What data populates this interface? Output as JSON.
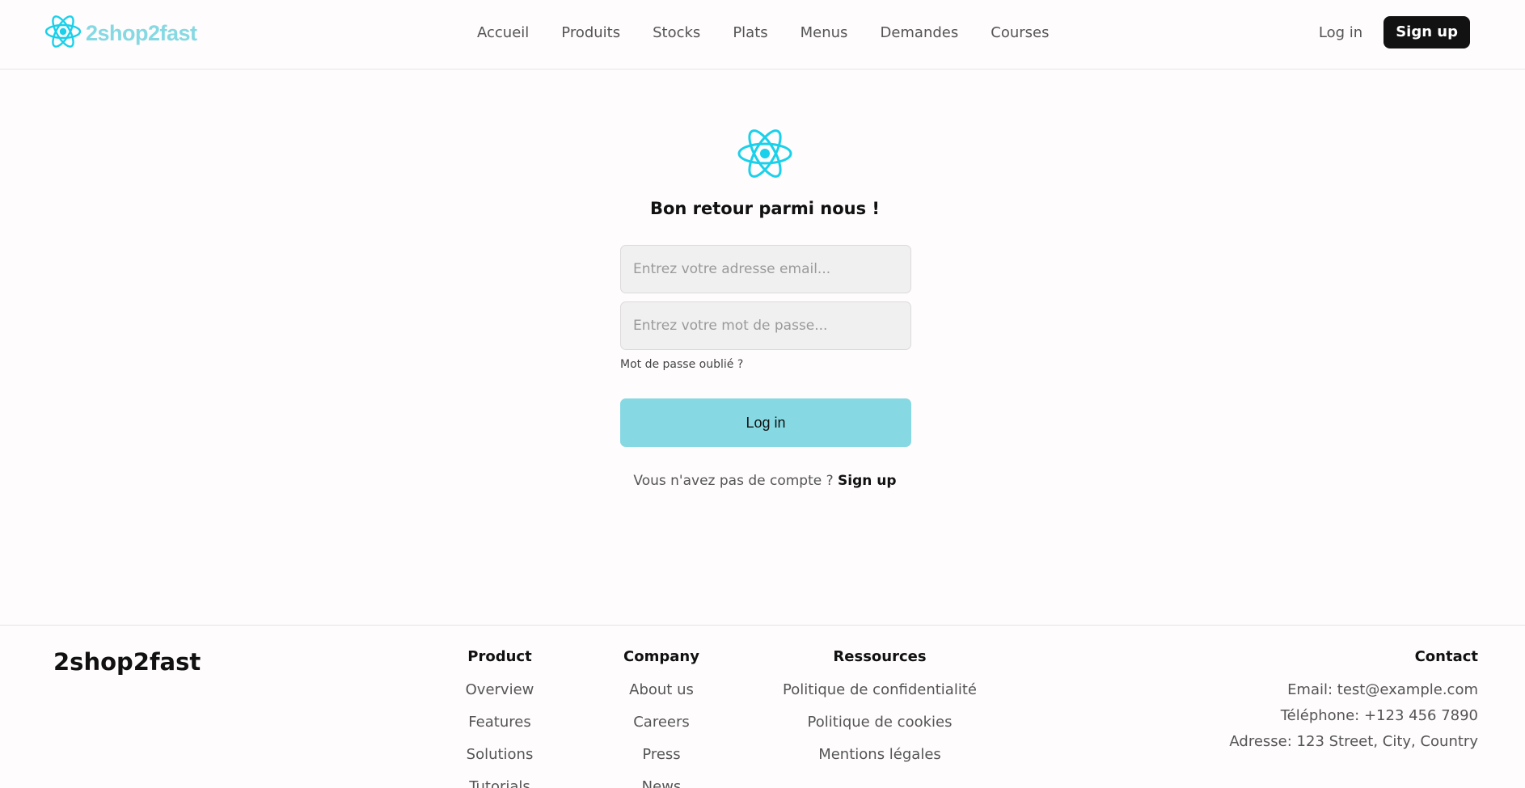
{
  "brand": {
    "name": "2shop2fast",
    "icon": "atom-icon",
    "color": "#86d9e3"
  },
  "nav": {
    "items": [
      "Accueil",
      "Produits",
      "Stocks",
      "Plats",
      "Menus",
      "Demandes",
      "Courses"
    ]
  },
  "auth": {
    "login": "Log in",
    "signup": "Sign up"
  },
  "login": {
    "welcome": "Bon retour parmi nous !",
    "email_placeholder": "Entrez votre adresse email...",
    "password_placeholder": "Entrez votre mot de passe...",
    "forgot": "Mot de passe oublié ?",
    "submit": "Log in",
    "no_account": "Vous n'avez pas de compte ?",
    "signup_link": "Sign up"
  },
  "footer": {
    "brand": "2shop2fast",
    "product": {
      "title": "Product",
      "items": [
        "Overview",
        "Features",
        "Solutions",
        "Tutorials"
      ]
    },
    "company": {
      "title": "Company",
      "items": [
        "About us",
        "Careers",
        "Press",
        "News"
      ]
    },
    "ressources": {
      "title": "Ressources",
      "items": [
        "Politique de confidentialité",
        "Politique de cookies",
        "Mentions légales"
      ]
    },
    "contact": {
      "title": "Contact",
      "email": "Email: test@example.com",
      "phone": "Téléphone: +123 456 7890",
      "address": "Adresse: 123 Street, City, Country"
    }
  }
}
